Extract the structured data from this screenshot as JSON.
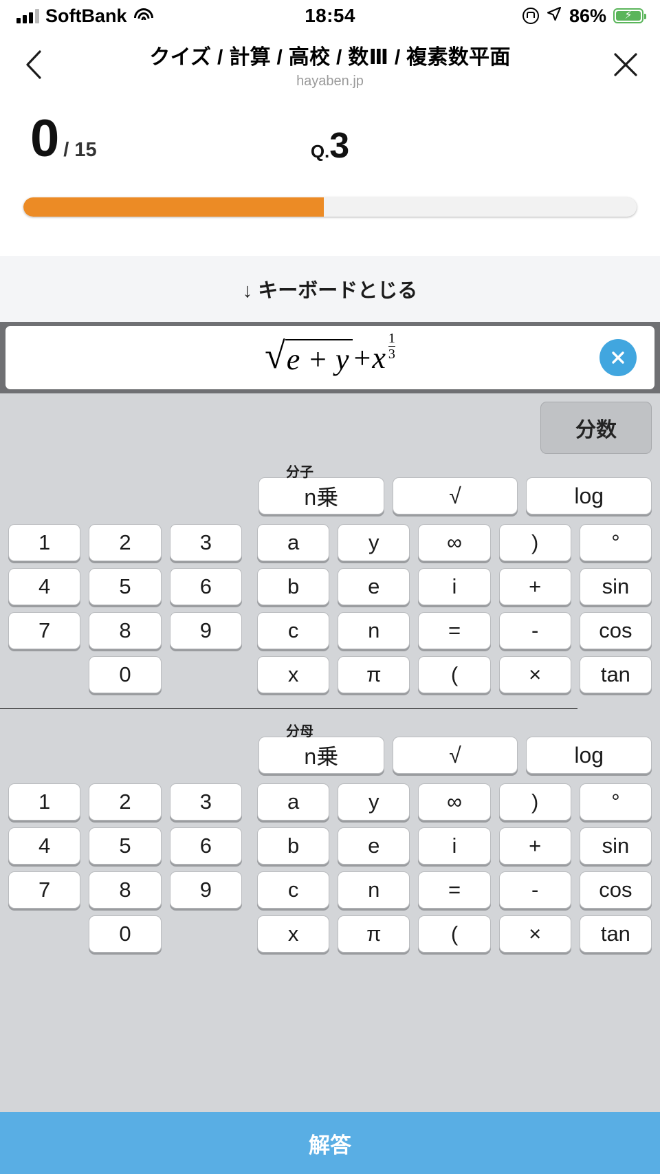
{
  "status_bar": {
    "carrier": "SoftBank",
    "time": "18:54",
    "battery_percent": "86%",
    "signal_icon": "signal-bars-icon",
    "wifi_icon": "wifi-icon",
    "rotation_lock_icon": "rotation-lock-icon",
    "location_icon": "location-arrow-icon",
    "battery_icon": "battery-charging-icon"
  },
  "navbar": {
    "back_icon": "chevron-left-icon",
    "close_icon": "close-icon",
    "title": "クイズ / 計算 / 高校 / 数Ⅲ / 複素数平面",
    "subtitle": "hayaben.jp"
  },
  "quiz": {
    "score": "0",
    "score_total": "/ 15",
    "question_label": "Q.",
    "question_number": "3",
    "progress_percent": 49,
    "progress_color": "#ec8b25",
    "question_peek": "＝"
  },
  "keyboard": {
    "close_label": "↓ キーボードとじる",
    "close_arrow_icon": "arrow-down-icon",
    "input_value": "√(e+y) + x^(1/3)",
    "formula": {
      "radicand": "e + y",
      "plus": "+",
      "base": "x",
      "exp_num": "1",
      "exp_den": "3"
    },
    "clear_icon": "clear-circle-x-icon",
    "mode_button": "分数",
    "numerator_label": "分子",
    "denominator_label": "分母",
    "function_keys": [
      "n乗",
      "√",
      "log"
    ],
    "number_keys": [
      "1",
      "2",
      "3",
      "4",
      "5",
      "6",
      "7",
      "8",
      "9",
      "",
      "0",
      ""
    ],
    "symbol_keys": [
      "a",
      "y",
      "∞",
      ")",
      "°",
      "b",
      "e",
      "i",
      "+",
      "sin",
      "c",
      "n",
      "=",
      "-",
      "cos",
      "x",
      "π",
      "(",
      "×",
      "tan"
    ]
  },
  "footer": {
    "answer_label": "解答",
    "answer_color": "#59aee4"
  }
}
